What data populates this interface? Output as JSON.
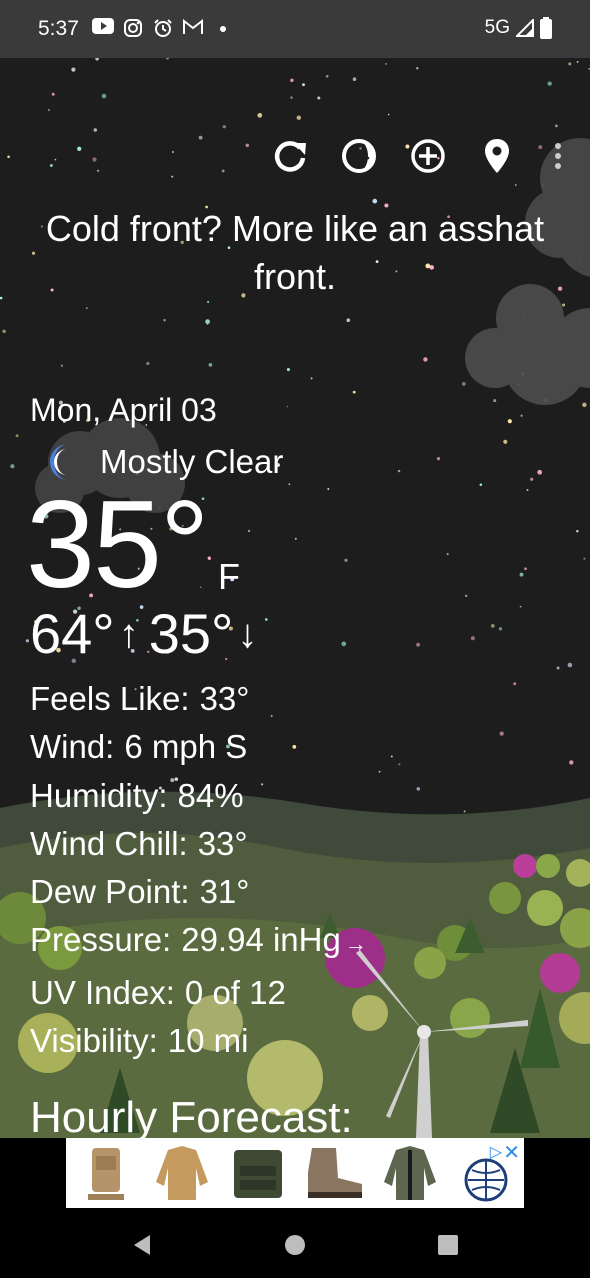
{
  "status_bar": {
    "time": "5:37",
    "network": "5G",
    "icons": [
      "youtube-icon",
      "instagram-icon",
      "alarm-icon",
      "gmail-icon",
      "dot-icon"
    ]
  },
  "toolbar": {
    "buttons": [
      "refresh-icon",
      "moon-phase-icon",
      "add-location-icon",
      "location-pin-icon",
      "more-icon"
    ]
  },
  "quote": "Cold front? More like an asshat front.",
  "current": {
    "date": "Mon, April 03",
    "condition": "Mostly Clear",
    "condition_icon": "crescent-moon-icon",
    "temperature": "35°",
    "unit": "F",
    "high": "64°",
    "low": "35°",
    "high_arrow": "↑",
    "low_arrow": "↓"
  },
  "details": [
    {
      "label": "Feels Like:",
      "value": "33°"
    },
    {
      "label": "Wind:",
      "value": "6 mph S"
    },
    {
      "label": "Humidity:",
      "value": "84%"
    },
    {
      "label": "Wind Chill:",
      "value": "33°"
    },
    {
      "label": "Dew Point:",
      "value": "31°"
    },
    {
      "label": "Pressure:",
      "value": "29.94 inHg",
      "trend": "→"
    },
    {
      "label": "UV Index:",
      "value": "0 of 12"
    },
    {
      "label": "Visibility:",
      "value": "10 mi"
    }
  ],
  "hourly_title": "Hourly Forecast:",
  "ad": {
    "info_icon": "adchoices-icon",
    "close_icon": "close-icon",
    "items": [
      "tactical-backpack",
      "tan-jacket",
      "plate-carrier-vest",
      "hiking-boot",
      "olive-jacket",
      "globe-logo"
    ]
  },
  "nav": [
    "back-icon",
    "home-icon",
    "recents-icon"
  ],
  "colors": {
    "sky": "#1d1d1d",
    "status_bar": "#3a3a3a",
    "moon": "#4a7fe0",
    "hill": "#5a6b3f"
  }
}
